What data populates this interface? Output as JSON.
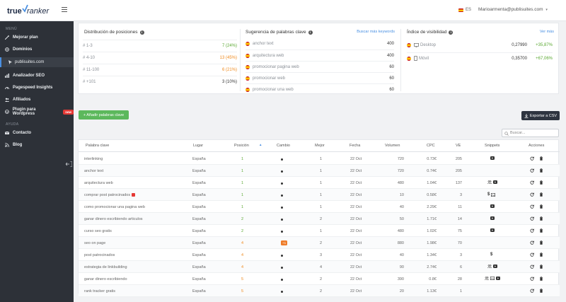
{
  "brand": {
    "word1": "true",
    "word2": "ranker"
  },
  "topbar": {
    "lang": "ES",
    "user_email": "Marioarmenta@publisuites.com"
  },
  "sidebar": {
    "menu_heading": "MENÚ",
    "items": [
      {
        "label": "Mejorar plan",
        "icon": "magic-icon"
      },
      {
        "label": "Dominios",
        "icon": "globe-icon"
      },
      {
        "label": "publisuites.com",
        "icon": "cursor-icon"
      },
      {
        "label": "Analizador SEO",
        "icon": "chart-icon"
      },
      {
        "label": "Pagespeed Insights",
        "icon": "speed-icon"
      },
      {
        "label": "Afiliados",
        "icon": "users-icon"
      },
      {
        "label": "Plugin para Wordpress",
        "icon": "wordpress-icon",
        "badge": "new"
      }
    ],
    "help_heading": "AYUDA",
    "help_items": [
      {
        "label": "Contacto",
        "icon": "mail-icon"
      },
      {
        "label": "Blog",
        "icon": "rss-icon"
      }
    ]
  },
  "stats": {
    "distribution": {
      "title": "Distribución de posiciones",
      "rows": [
        {
          "label": "# 1-3",
          "value": "7 (24%)",
          "color": "#5aa832"
        },
        {
          "label": "# 4-10",
          "value": "13 (45%)",
          "color": "#ef8a1e"
        },
        {
          "label": "# 11-100",
          "value": "6 (21%)",
          "color": "#ef8a1e"
        },
        {
          "label": "# +101",
          "value": "3 (10%)",
          "color": "#333333"
        }
      ]
    },
    "suggestions": {
      "title": "Sugerencia de palabras clave",
      "link": "Buscar más keywords",
      "rows": [
        {
          "label": "anchor text",
          "value": "400"
        },
        {
          "label": "arquitectura web",
          "value": "400"
        },
        {
          "label": "promocionar pagina web",
          "value": "60"
        },
        {
          "label": "promocionar web",
          "value": "60"
        },
        {
          "label": "promocionar una web",
          "value": "60"
        }
      ]
    },
    "visibility": {
      "title": "Índice de visibilidad",
      "link": "Ver más",
      "rows": [
        {
          "label": "Desktop",
          "value": "0,27990",
          "delta": "+35,87%"
        },
        {
          "label": "Móvil",
          "value": "0,35700",
          "delta": "+67,06%"
        }
      ]
    }
  },
  "toolbar": {
    "add_label": "+ Añadir palabras clave",
    "export_label": "Exportar a CSV",
    "search_placeholder": "Buscar..."
  },
  "table": {
    "headers": [
      "Palabra clave",
      "Lugar",
      "Posición",
      "Cambio",
      "Mejor",
      "Fecha",
      "Volumen",
      "CPC",
      "VE",
      "Snippets",
      "Acciones"
    ],
    "rows": [
      {
        "kw": "interlinking",
        "place": "España",
        "pos": "1",
        "posc": "pos1",
        "change": "dot",
        "best": "1",
        "date": "22 Oct",
        "vol": "720",
        "cpc": "0.73€",
        "ve": "205",
        "snip": [
          "video"
        ]
      },
      {
        "kw": "anchor text",
        "place": "España",
        "pos": "1",
        "posc": "pos1",
        "change": "dot",
        "best": "1",
        "date": "22 Oct",
        "vol": "720",
        "cpc": "0.74€",
        "ve": "205",
        "snip": []
      },
      {
        "kw": "arquitectura web",
        "place": "España",
        "pos": "1",
        "posc": "pos1",
        "change": "dot",
        "best": "1",
        "date": "22 Oct",
        "vol": "480",
        "cpc": "1.04€",
        "ve": "137",
        "snip": [
          "people",
          "video"
        ]
      },
      {
        "kw": "comprar post patrocinados",
        "place": "España",
        "pos": "1",
        "posc": "pos1",
        "change": "dot",
        "best": "1",
        "date": "22 Oct",
        "vol": "10",
        "cpc": "0.58€",
        "ve": "3",
        "snip": [
          "dollar",
          "image"
        ],
        "gift": true
      },
      {
        "kw": "como promocionar una pagina web",
        "place": "España",
        "pos": "1",
        "posc": "pos1",
        "change": "dot",
        "best": "1",
        "date": "22 Oct",
        "vol": "40",
        "cpc": "2.29€",
        "ve": "11",
        "snip": [
          "video"
        ]
      },
      {
        "kw": "ganar dinero escribiendo articulos",
        "place": "España",
        "pos": "2",
        "posc": "pos1",
        "change": "dot",
        "best": "2",
        "date": "22 Oct",
        "vol": "50",
        "cpc": "1.71€",
        "ve": "14",
        "snip": [
          "video"
        ]
      },
      {
        "kw": "curso seo gratis",
        "place": "España",
        "pos": "2",
        "posc": "pos1",
        "change": "dot",
        "best": "1",
        "date": "22 Oct",
        "vol": "480",
        "cpc": "1.02€",
        "ve": "75",
        "snip": [
          "video"
        ]
      },
      {
        "kw": "seo on page",
        "place": "España",
        "pos": "4",
        "posc": "pos2",
        "change": "+1",
        "best": "2",
        "date": "22 Oct",
        "vol": "880",
        "cpc": "1.98€",
        "ve": "70",
        "snip": []
      },
      {
        "kw": "post patrocinados",
        "place": "España",
        "pos": "4",
        "posc": "pos2",
        "change": "dot",
        "best": "3",
        "date": "22 Oct",
        "vol": "40",
        "cpc": "1.34€",
        "ve": "3",
        "snip": [
          "dollar"
        ]
      },
      {
        "kw": "estrategia de linkbuilding",
        "place": "España",
        "pos": "4",
        "posc": "pos2",
        "change": "dot",
        "best": "4",
        "date": "22 Oct",
        "vol": "90",
        "cpc": "2.74€",
        "ve": "6",
        "snip": [
          "people",
          "video"
        ]
      },
      {
        "kw": "ganar dinero escribiendo",
        "place": "España",
        "pos": "5",
        "posc": "pos2",
        "change": "dot",
        "best": "2",
        "date": "22 Oct",
        "vol": "390",
        "cpc": "0.8€",
        "ve": "28",
        "snip": [
          "people",
          "image",
          "video"
        ]
      },
      {
        "kw": "rank tracker gratis",
        "place": "España",
        "pos": "5",
        "posc": "pos2",
        "change": "dot",
        "best": "2",
        "date": "22 Oct",
        "vol": "20",
        "cpc": "1.13€",
        "ve": "1",
        "snip": []
      }
    ]
  }
}
